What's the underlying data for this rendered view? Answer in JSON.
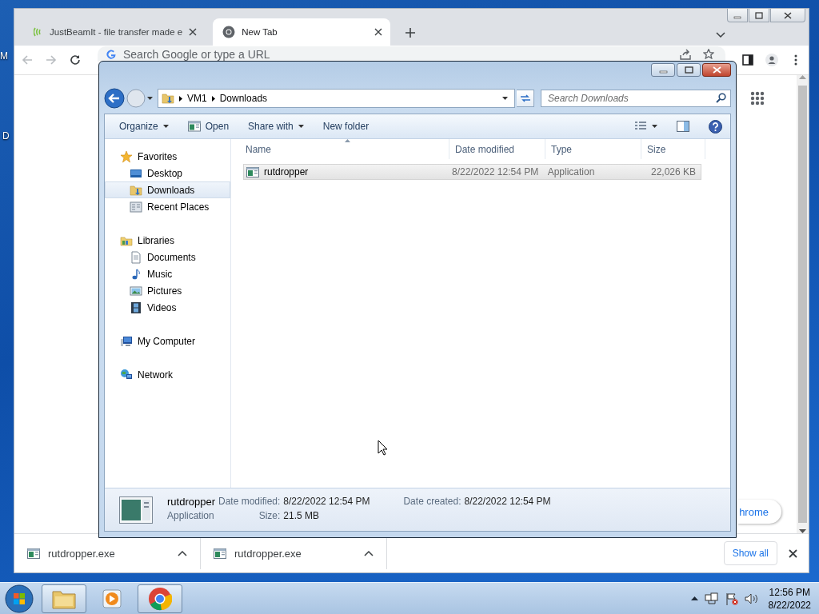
{
  "desktop": {
    "labels": [
      "M",
      "D"
    ]
  },
  "chrome": {
    "tabs": [
      {
        "kind": "site",
        "title": "JustBeamIt - file transfer made e",
        "selected": false
      },
      {
        "kind": "new_tab",
        "title": "New Tab",
        "selected": true
      }
    ],
    "omnibox": {
      "placeholder": "Search Google or type a URL"
    },
    "page": {
      "customize_button": "hrome"
    },
    "downloads": {
      "items": [
        "rutdropper.exe",
        "rutdropper.exe"
      ],
      "show_all": "Show all"
    }
  },
  "explorer": {
    "breadcrumb": [
      "VM1",
      "Downloads"
    ],
    "search": {
      "placeholder": "Search Downloads"
    },
    "commands": [
      {
        "label": "Organize",
        "dropdown": true,
        "kind": "plain"
      },
      {
        "label": "Open",
        "dropdown": false,
        "kind": "open"
      },
      {
        "label": "Share with",
        "dropdown": true,
        "kind": "plain"
      },
      {
        "label": "New folder",
        "dropdown": false,
        "kind": "plain"
      }
    ],
    "nav": [
      {
        "label": "Favorites",
        "kind": "star",
        "selected": false,
        "children": [
          {
            "label": "Desktop",
            "kind": "desktop",
            "selected": false
          },
          {
            "label": "Downloads",
            "kind": "downloads",
            "selected": true
          },
          {
            "label": "Recent Places",
            "kind": "recent",
            "selected": false
          }
        ]
      },
      {
        "label": "Libraries",
        "kind": "library",
        "selected": false,
        "children": [
          {
            "label": "Documents",
            "kind": "documents",
            "selected": false
          },
          {
            "label": "Music",
            "kind": "music",
            "selected": false
          },
          {
            "label": "Pictures",
            "kind": "pictures",
            "selected": false
          },
          {
            "label": "Videos",
            "kind": "videos",
            "selected": false
          }
        ]
      },
      {
        "label": "My Computer",
        "kind": "computer",
        "selected": false
      },
      {
        "label": "Network",
        "kind": "network",
        "selected": false
      }
    ],
    "columns": [
      "Name",
      "Date modified",
      "Type",
      "Size"
    ],
    "files": [
      {
        "name": "rutdropper",
        "date_modified": "8/22/2022 12:54 PM",
        "type": "Application",
        "size": "22,026 KB",
        "selected": true
      }
    ],
    "details": {
      "name": "rutdropper",
      "type": "Application",
      "fields": [
        {
          "label": "Date modified:",
          "value": "8/22/2022 12:54 PM"
        },
        {
          "label": "Date created:",
          "value": "8/22/2022 12:54 PM"
        },
        {
          "label": "Size:",
          "value": "21.5 MB"
        }
      ]
    }
  },
  "taskbar": {
    "apps": [
      {
        "kind": "explorer",
        "active": true
      },
      {
        "kind": "media",
        "active": false
      },
      {
        "kind": "chrome",
        "active": true
      }
    ],
    "clock": {
      "time": "12:56 PM",
      "date": "8/22/2022"
    }
  }
}
